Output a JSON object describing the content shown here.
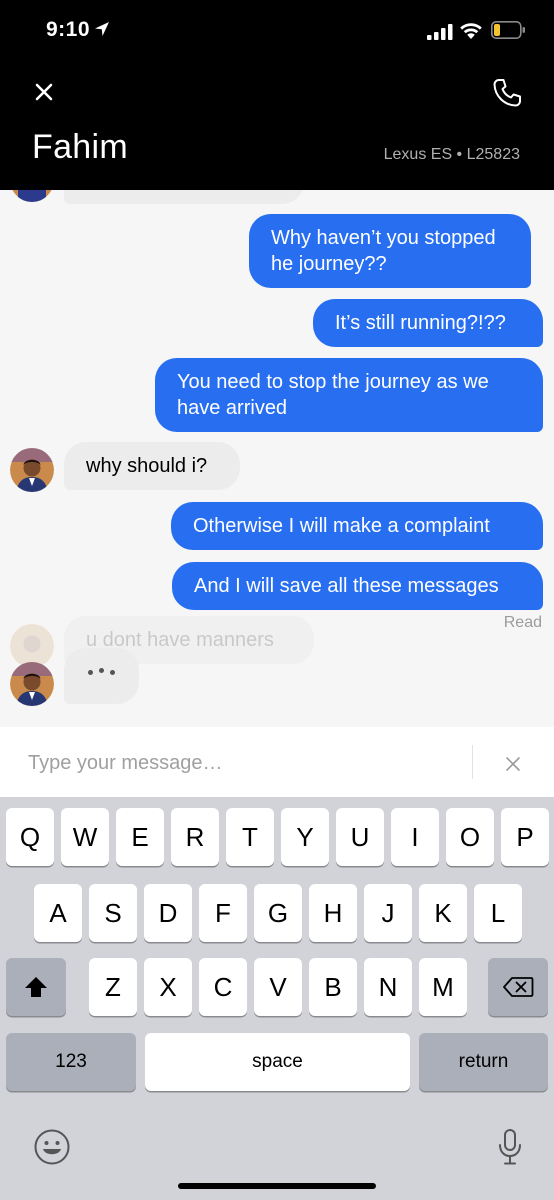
{
  "status_bar": {
    "time": "9:10"
  },
  "header": {
    "contact_name": "Fahim",
    "vehicle": "Lexus ES • L25823"
  },
  "messages": [
    {
      "from": "me",
      "text": "Why haven’t you stopped he journey??"
    },
    {
      "from": "me",
      "text": "It’s still running?!??"
    },
    {
      "from": "me",
      "text": "You need to stop the journey as we have arrived"
    },
    {
      "from": "driver",
      "text": "why should i?"
    },
    {
      "from": "me",
      "text": "Otherwise I will make a complaint"
    },
    {
      "from": "me",
      "text": "And I will save all these messages"
    },
    {
      "from": "driver",
      "text": "u dont have manners"
    }
  ],
  "read_receipt": "Read",
  "input": {
    "placeholder": "Type your message…",
    "value": ""
  },
  "keyboard": {
    "row1": [
      "Q",
      "W",
      "E",
      "R",
      "T",
      "Y",
      "U",
      "I",
      "O",
      "P"
    ],
    "row2": [
      "A",
      "S",
      "D",
      "F",
      "G",
      "H",
      "J",
      "K",
      "L"
    ],
    "row3": [
      "Z",
      "X",
      "C",
      "V",
      "B",
      "N",
      "M"
    ],
    "numbers": "123",
    "space": "space",
    "return": "return"
  },
  "colors": {
    "accent": "#276ef1",
    "incoming_bubble": "#ececec",
    "chat_bg": "#f6f6f6",
    "keyboard_bg": "#d1d3d9"
  }
}
